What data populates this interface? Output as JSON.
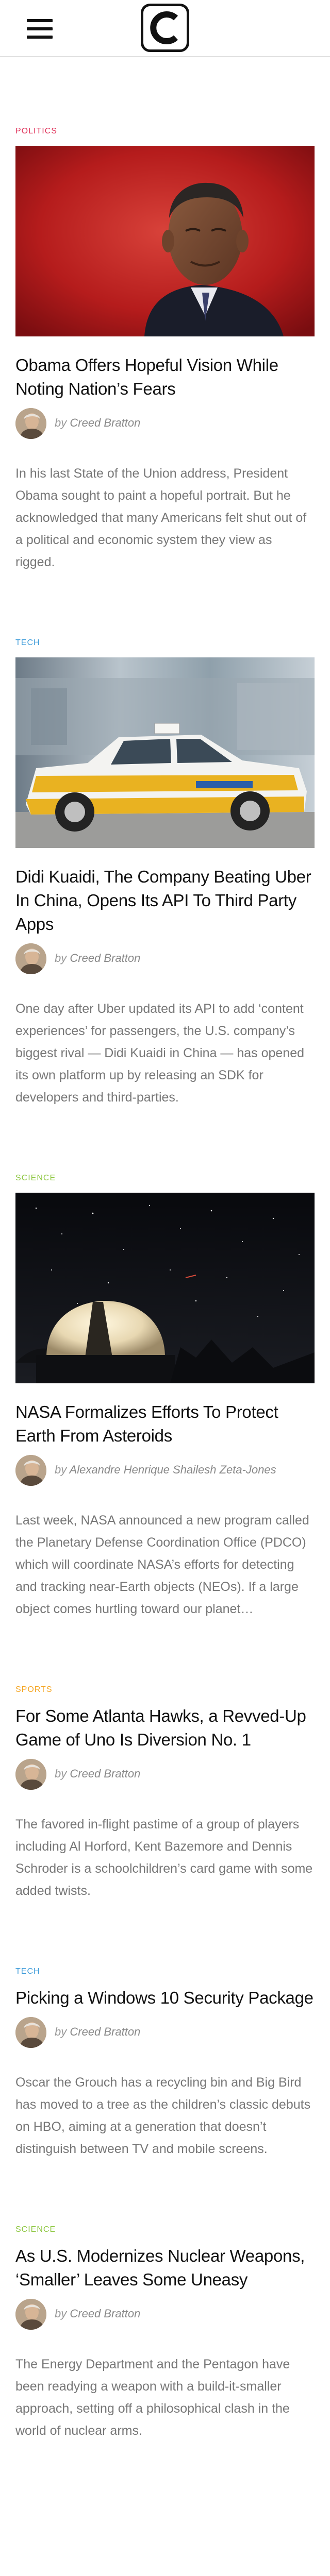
{
  "header": {
    "menu_icon": "hamburger-menu-icon",
    "logo_letter": "C"
  },
  "colors": {
    "politics": "#e0355c",
    "tech": "#3a9ad9",
    "science": "#8cc63f",
    "sports": "#f5a623",
    "headline": "#111111",
    "excerpt": "#777777"
  },
  "articles": [
    {
      "category": "Politics",
      "category_color": "#e0355c",
      "has_image": true,
      "image": "obama-portrait",
      "headline": "Obama Offers Hopeful Vision While Noting Nation’s Fears",
      "by_label": "by",
      "author": "Creed Bratton",
      "excerpt": "In his last State of the Union address, President Obama sought to paint a hopeful portrait. But he acknowledged that many Americans felt shut out of a political and economic system they view as rigged."
    },
    {
      "category": "Tech",
      "category_color": "#3a9ad9",
      "has_image": true,
      "image": "taxi-car",
      "headline": "Didi Kuaidi, The Company Beating Uber In China, Opens Its API To Third Party Apps",
      "by_label": "by",
      "author": "Creed Bratton",
      "excerpt": "One day after Uber updated its API to add ‘content experiences’ for passengers, the U.S. company’s biggest rival — Didi Kuaidi in China — has opened its own platform up by releasing an SDK for developers and third-parties."
    },
    {
      "category": "Science",
      "category_color": "#8cc63f",
      "has_image": true,
      "image": "observatory-night",
      "headline": "NASA Formalizes Efforts To Protect Earth From Asteroids",
      "by_label": "by",
      "author": "Alexandre Henrique Shailesh Zeta-Jones",
      "excerpt": "Last week, NASA announced a new program called the Planetary Defense Coordination Office (PDCO) which will coordinate NASA’s efforts for detecting and tracking near-Earth objects (NEOs). If a large object comes hurtling toward our planet…"
    },
    {
      "category": "Sports",
      "category_color": "#f5a623",
      "has_image": false,
      "headline": "For Some Atlanta Hawks, a Revved-Up Game of Uno Is Diversion No. 1",
      "by_label": "by",
      "author": "Creed Bratton",
      "excerpt": "The favored in-flight pastime of a group of players including Al Horford, Kent Bazemore and Dennis Schroder is a schoolchildren’s card game with some added twists."
    },
    {
      "category": "Tech",
      "category_color": "#3a9ad9",
      "has_image": false,
      "headline": "Picking a Windows 10 Security Package",
      "by_label": "by",
      "author": "Creed Bratton",
      "excerpt": "Oscar the Grouch has a recycling bin and Big Bird has moved to a tree as the children’s classic debuts on HBO, aiming at a generation that doesn’t distinguish between TV and mobile screens."
    },
    {
      "category": "Science",
      "category_color": "#8cc63f",
      "has_image": false,
      "headline": "As U.S. Modernizes Nuclear Weapons, ‘Smaller’ Leaves Some Uneasy",
      "by_label": "by",
      "author": "Creed Bratton",
      "excerpt": "The Energy Department and the Pentagon have been readying a weapon with a build-it-smaller approach, setting off a philosophical clash in the world of nuclear arms."
    }
  ]
}
